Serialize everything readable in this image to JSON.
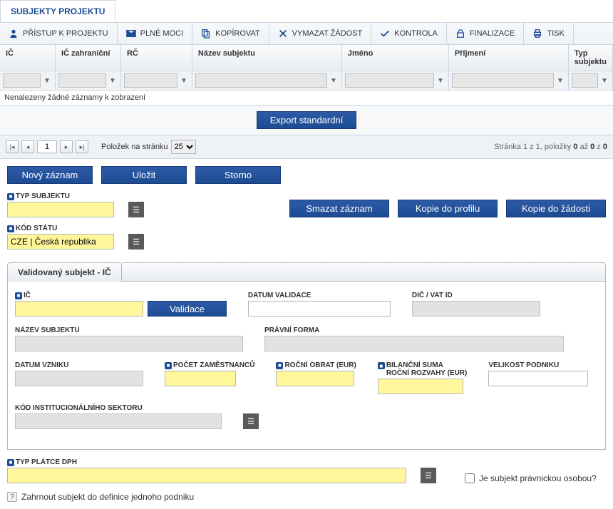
{
  "tab_title": "SUBJEKTY PROJEKTU",
  "toolbar": {
    "access": "PŘÍSTUP K PROJEKTU",
    "power": "PLNÉ MOCI",
    "copy": "KOPÍROVAT",
    "delete": "VYMAZAT ŽÁDOST",
    "check": "KONTROLA",
    "finalize": "FINALIZACE",
    "print": "TISK"
  },
  "grid": {
    "headers": {
      "ic": "IČ",
      "ic_foreign": "IČ zahraniční",
      "rc": "RČ",
      "name": "Název subjektu",
      "first": "Jméno",
      "last": "Příjmení",
      "type": "Typ subjektu"
    },
    "empty_msg": "Nenalezeny žádné záznamy k zobrazení",
    "export_btn": "Export standardní"
  },
  "pager": {
    "page": "1",
    "per_page_label": "Položek na stránku",
    "per_page": "25",
    "info_left": "Stránka 1 z 1, položky ",
    "info_bold1": "0",
    "info_mid": " až ",
    "info_bold2": "0",
    "info_end": " z ",
    "info_bold3": "0"
  },
  "actions": {
    "new": "Nový záznam",
    "save": "Uložit",
    "cancel": "Storno",
    "delete_rec": "Smazat záznam",
    "copy_profile": "Kopie do profilu",
    "copy_request": "Kopie do žádosti"
  },
  "fields": {
    "type_label": "TYP SUBJEKTU",
    "state_label": "KÓD STÁTU",
    "state_value": "CZE | Česká republika",
    "subtab": "Validovaný subjekt - IČ",
    "ic_label": "IČ",
    "validate_btn": "Validace",
    "date_valid": "DATUM VALIDACE",
    "dic": "DIČ / VAT ID",
    "name": "NÁZEV SUBJEKTU",
    "legal_form": "PRÁVNÍ FORMA",
    "date_created": "DATUM VZNIKU",
    "employees": "POČET ZAMĚSTNANCŮ",
    "turnover": "ROČNÍ OBRAT (EUR)",
    "balance_l1": "BILANČNÍ SUMA",
    "balance_l2": "ROČNÍ ROZVAHY (EUR)",
    "size": "VELIKOST PODNIKU",
    "inst_code": "KÓD INSTITUCIONÁLNÍHO SEKTORU",
    "vat_type": "TYP PLÁTCE DPH",
    "is_legal": "Je subjekt právnickou osobou?",
    "include": "Zahrnout subjekt do definice jednoho podniku"
  }
}
